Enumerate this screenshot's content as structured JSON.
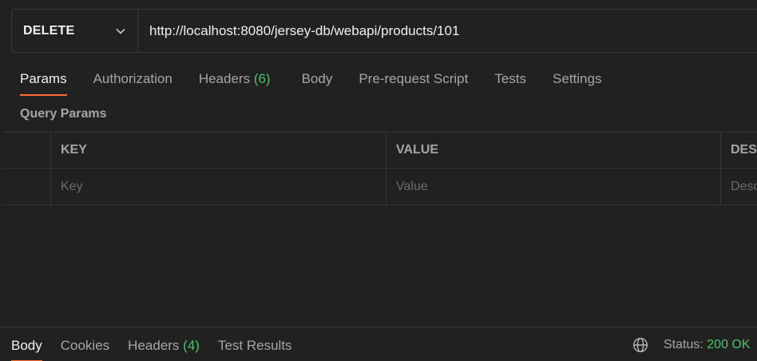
{
  "request": {
    "method": "DELETE",
    "url": "http://localhost:8080/jersey-db/webapi/products/101"
  },
  "tabs": {
    "params": "Params",
    "authorization": "Authorization",
    "headers": "Headers",
    "headers_count": "(6)",
    "body": "Body",
    "prerequest": "Pre-request Script",
    "tests": "Tests",
    "settings": "Settings"
  },
  "query_params": {
    "title": "Query Params",
    "columns": {
      "key": "KEY",
      "value": "VALUE",
      "description": "DESCRIPTION"
    },
    "placeholders": {
      "key": "Key",
      "value": "Value",
      "description": "Description"
    }
  },
  "response": {
    "tabs": {
      "body": "Body",
      "cookies": "Cookies",
      "headers": "Headers",
      "headers_count": "(4)",
      "test_results": "Test Results"
    },
    "status_label": "Status:",
    "status_value": "200 OK"
  },
  "colors": {
    "accent": "#ff6c37",
    "success": "#4fc26a",
    "background": "#212121"
  },
  "icons": {
    "method_dropdown": "chevron-down-icon",
    "environment": "globe-icon"
  }
}
